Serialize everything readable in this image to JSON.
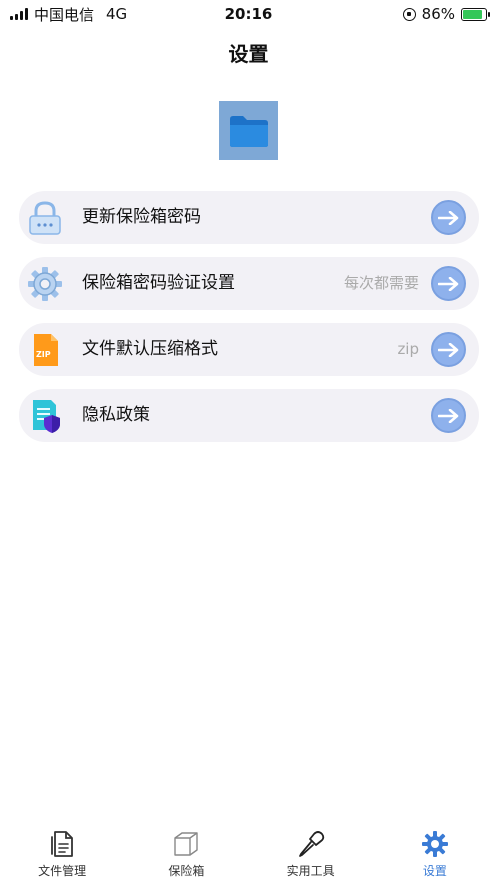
{
  "status_bar": {
    "carrier": "中国电信",
    "network": "4G",
    "time": "20:16",
    "battery": "86%",
    "battery_level": 0.86
  },
  "header": {
    "title": "设置"
  },
  "settings": [
    {
      "label": "更新保险箱密码",
      "value": "",
      "icon": "lock-icon"
    },
    {
      "label": "保险箱密码验证设置",
      "value": "每次都需要",
      "icon": "gear-icon"
    },
    {
      "label": "文件默认压缩格式",
      "value": "zip",
      "icon": "zip-file-icon",
      "icon_text": "ZIP"
    },
    {
      "label": "隐私政策",
      "value": "",
      "icon": "privacy-shield-icon"
    }
  ],
  "tabs": [
    {
      "label": "文件管理",
      "icon": "file-document-icon",
      "active": false
    },
    {
      "label": "保险箱",
      "icon": "box-icon",
      "active": false
    },
    {
      "label": "实用工具",
      "icon": "screwdriver-icon",
      "active": false
    },
    {
      "label": "设置",
      "icon": "gear-icon",
      "active": true
    }
  ],
  "colors": {
    "accent": "#3a7bd5",
    "arrow_button": "#8eb1ec",
    "row_background": "#f2f1f6",
    "value_text": "#aaaaaa"
  }
}
